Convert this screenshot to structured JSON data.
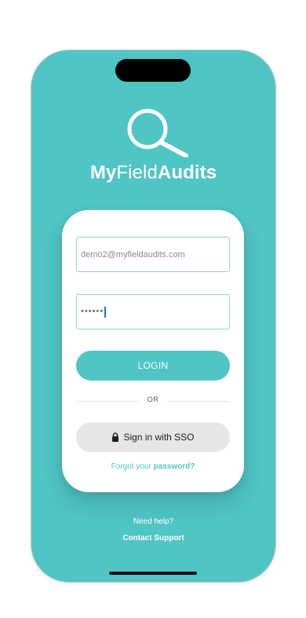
{
  "brand": {
    "bold_part_1": "My",
    "normal_part": "Field",
    "bold_part_2": "Audits"
  },
  "login_form": {
    "email_value": "demo2@myfieldaudits.com",
    "password_masked": "••••••",
    "login_label": "LOGIN",
    "or_label": "OR",
    "sso_label": "Sign in with SSO",
    "forgot_prefix": "Forgot your ",
    "forgot_link": "password?"
  },
  "footer": {
    "help_text": "Need help?",
    "support_link": "Contact Support"
  },
  "icons": {
    "logo": "magnifier-icon",
    "sso": "lock-icon"
  },
  "colors": {
    "accent": "#4fc5c5",
    "sso_button": "#e6e6e6",
    "card": "#ffffff"
  }
}
